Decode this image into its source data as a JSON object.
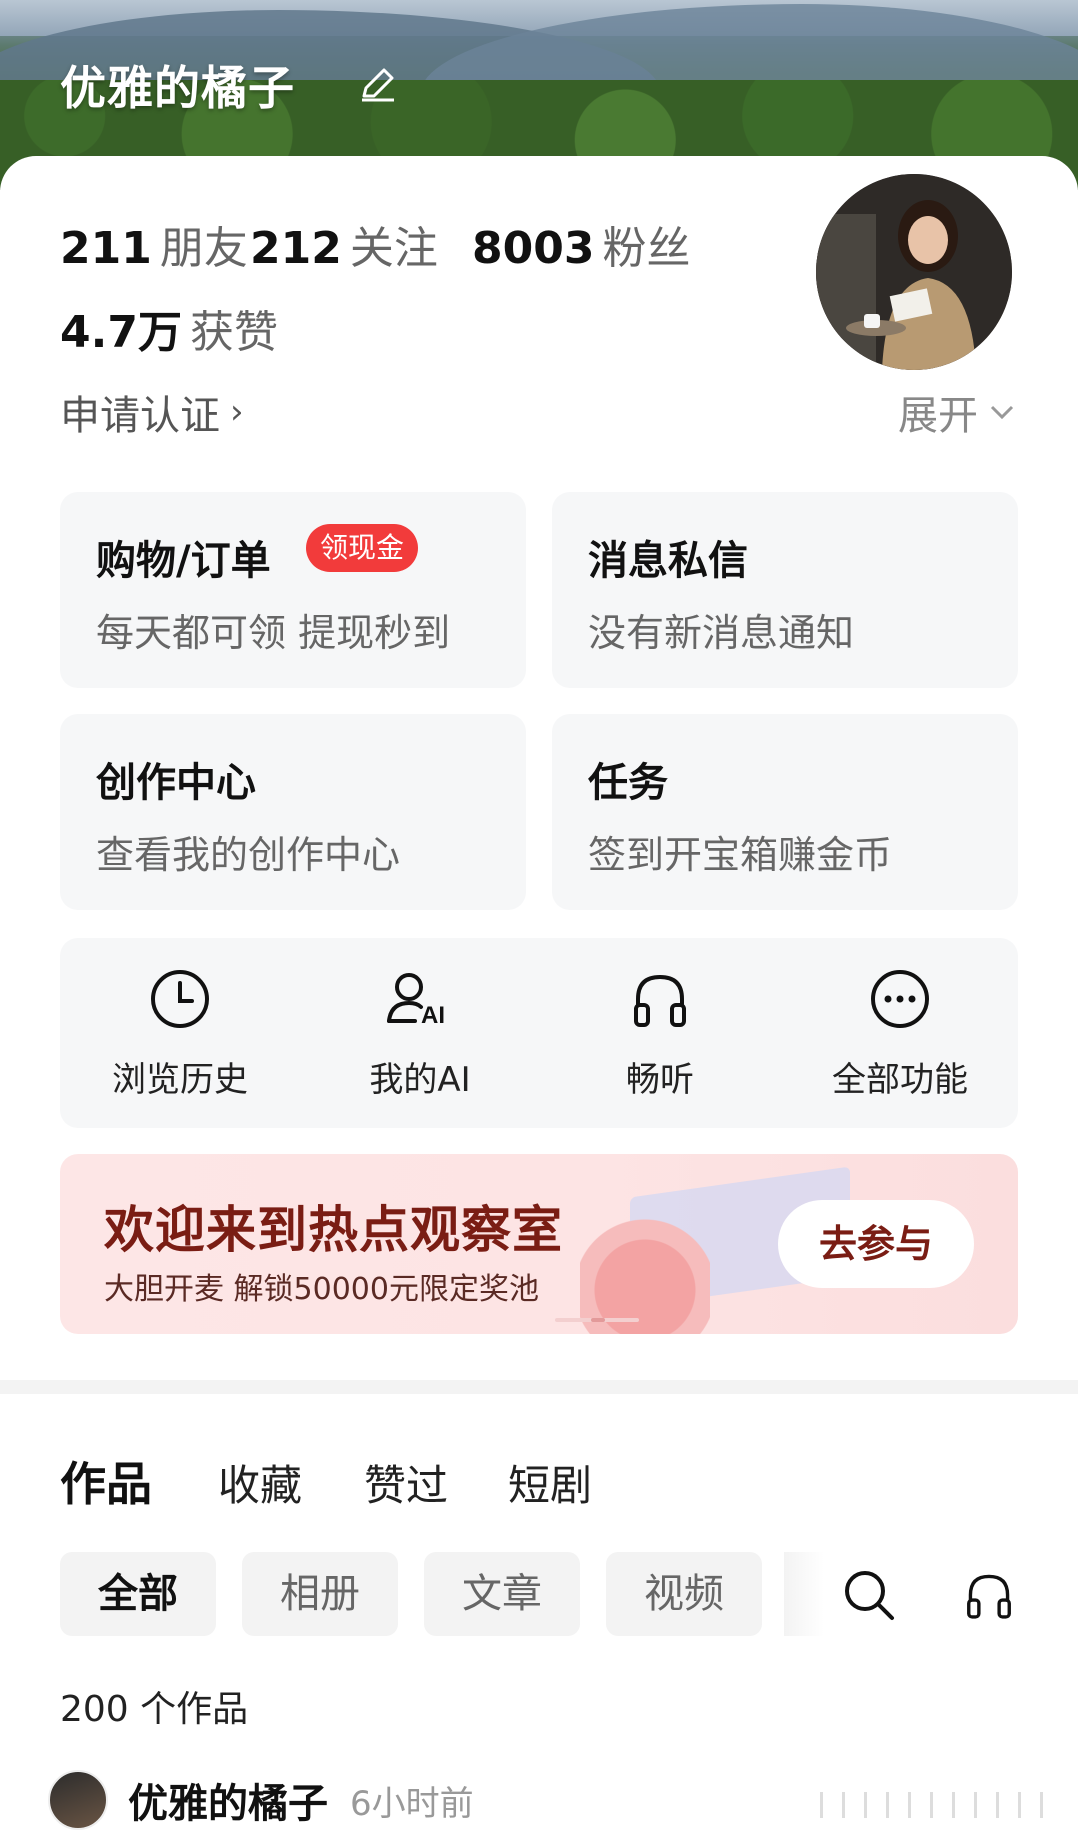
{
  "profile": {
    "name": "优雅的橘子",
    "stats": [
      {
        "value": "211",
        "label": "朋友"
      },
      {
        "value": "212",
        "label": "关注"
      },
      {
        "value": "8003",
        "label": "粉丝"
      }
    ],
    "likes": {
      "value": "4.7万",
      "label": "获赞"
    },
    "verify_label": "申请认证",
    "expand_label": "展开"
  },
  "tiles": [
    {
      "title": "购物/订单",
      "badge": "领现金",
      "subtitle": "每天都可领 提现秒到"
    },
    {
      "title": "消息私信",
      "subtitle": "没有新消息通知"
    },
    {
      "title": "创作中心",
      "subtitle": "查看我的创作中心"
    },
    {
      "title": "任务",
      "subtitle": "签到开宝箱赚金币"
    }
  ],
  "quick_actions": [
    {
      "label": "浏览历史",
      "icon": "clock-icon"
    },
    {
      "label": "我的AI",
      "icon": "ai-user-icon"
    },
    {
      "label": "畅听",
      "icon": "headphones-icon"
    },
    {
      "label": "全部功能",
      "icon": "more-dots-icon"
    }
  ],
  "banner": {
    "title": "欢迎来到热点观察室",
    "subtitle": "大胆开麦 解锁50000元限定奖池",
    "cta": "去参与"
  },
  "content_tabs": [
    "作品",
    "收藏",
    "赞过",
    "短剧"
  ],
  "filter_chips": [
    "全部",
    "相册",
    "文章",
    "视频"
  ],
  "works_count": "200 个作品",
  "post": {
    "author": "优雅的橘子",
    "time": "6小时前"
  },
  "colors": {
    "badge": "#f23b3b",
    "banner_text": "#7a1d14",
    "tile_bg": "#f6f7f8"
  }
}
